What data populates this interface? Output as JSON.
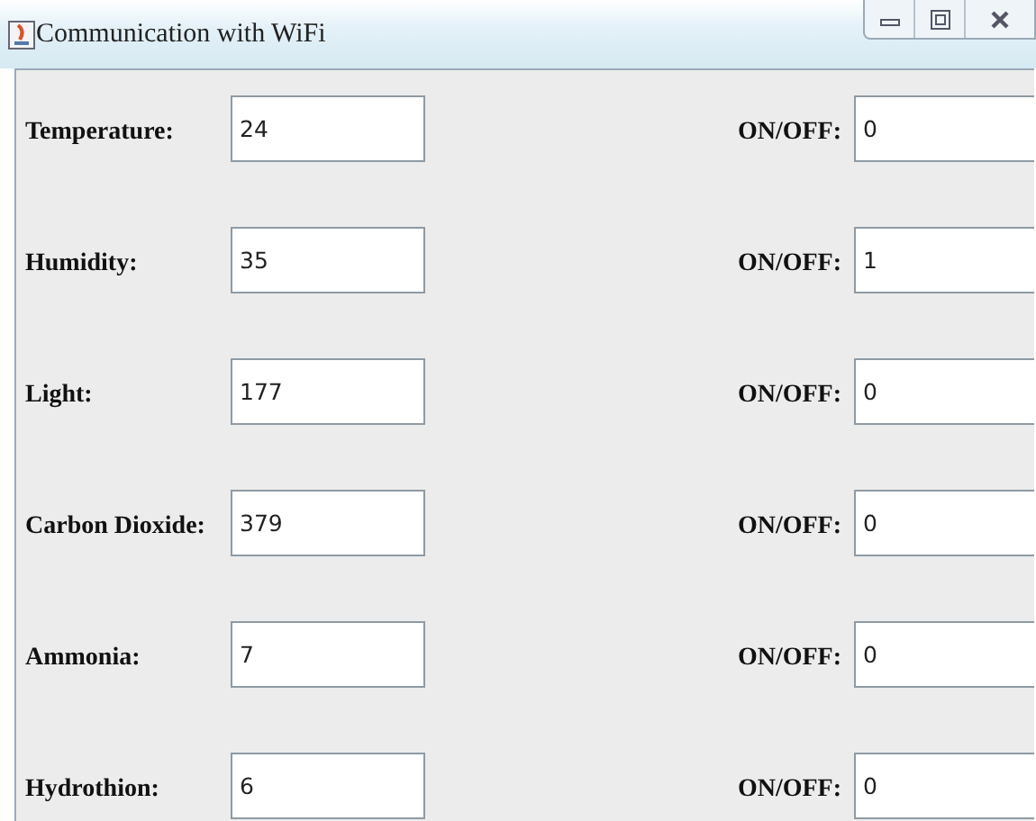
{
  "window": {
    "title": "Communication with WiFi"
  },
  "rows": [
    {
      "label": "Temperature:",
      "value": "24",
      "switch_label": "ON/OFF:",
      "switch_value": "0"
    },
    {
      "label": "Humidity:",
      "value": "35",
      "switch_label": "ON/OFF:",
      "switch_value": "1"
    },
    {
      "label": "Light:",
      "value": "177",
      "switch_label": "ON/OFF:",
      "switch_value": "0"
    },
    {
      "label": "Carbon Dioxide:",
      "value": "379",
      "switch_label": "ON/OFF:",
      "switch_value": "0"
    },
    {
      "label": "Ammonia:",
      "value": "7",
      "switch_label": "ON/OFF:",
      "switch_value": "0"
    },
    {
      "label": "Hydrothion:",
      "value": "6",
      "switch_label": "ON/OFF:",
      "switch_value": "0"
    }
  ]
}
